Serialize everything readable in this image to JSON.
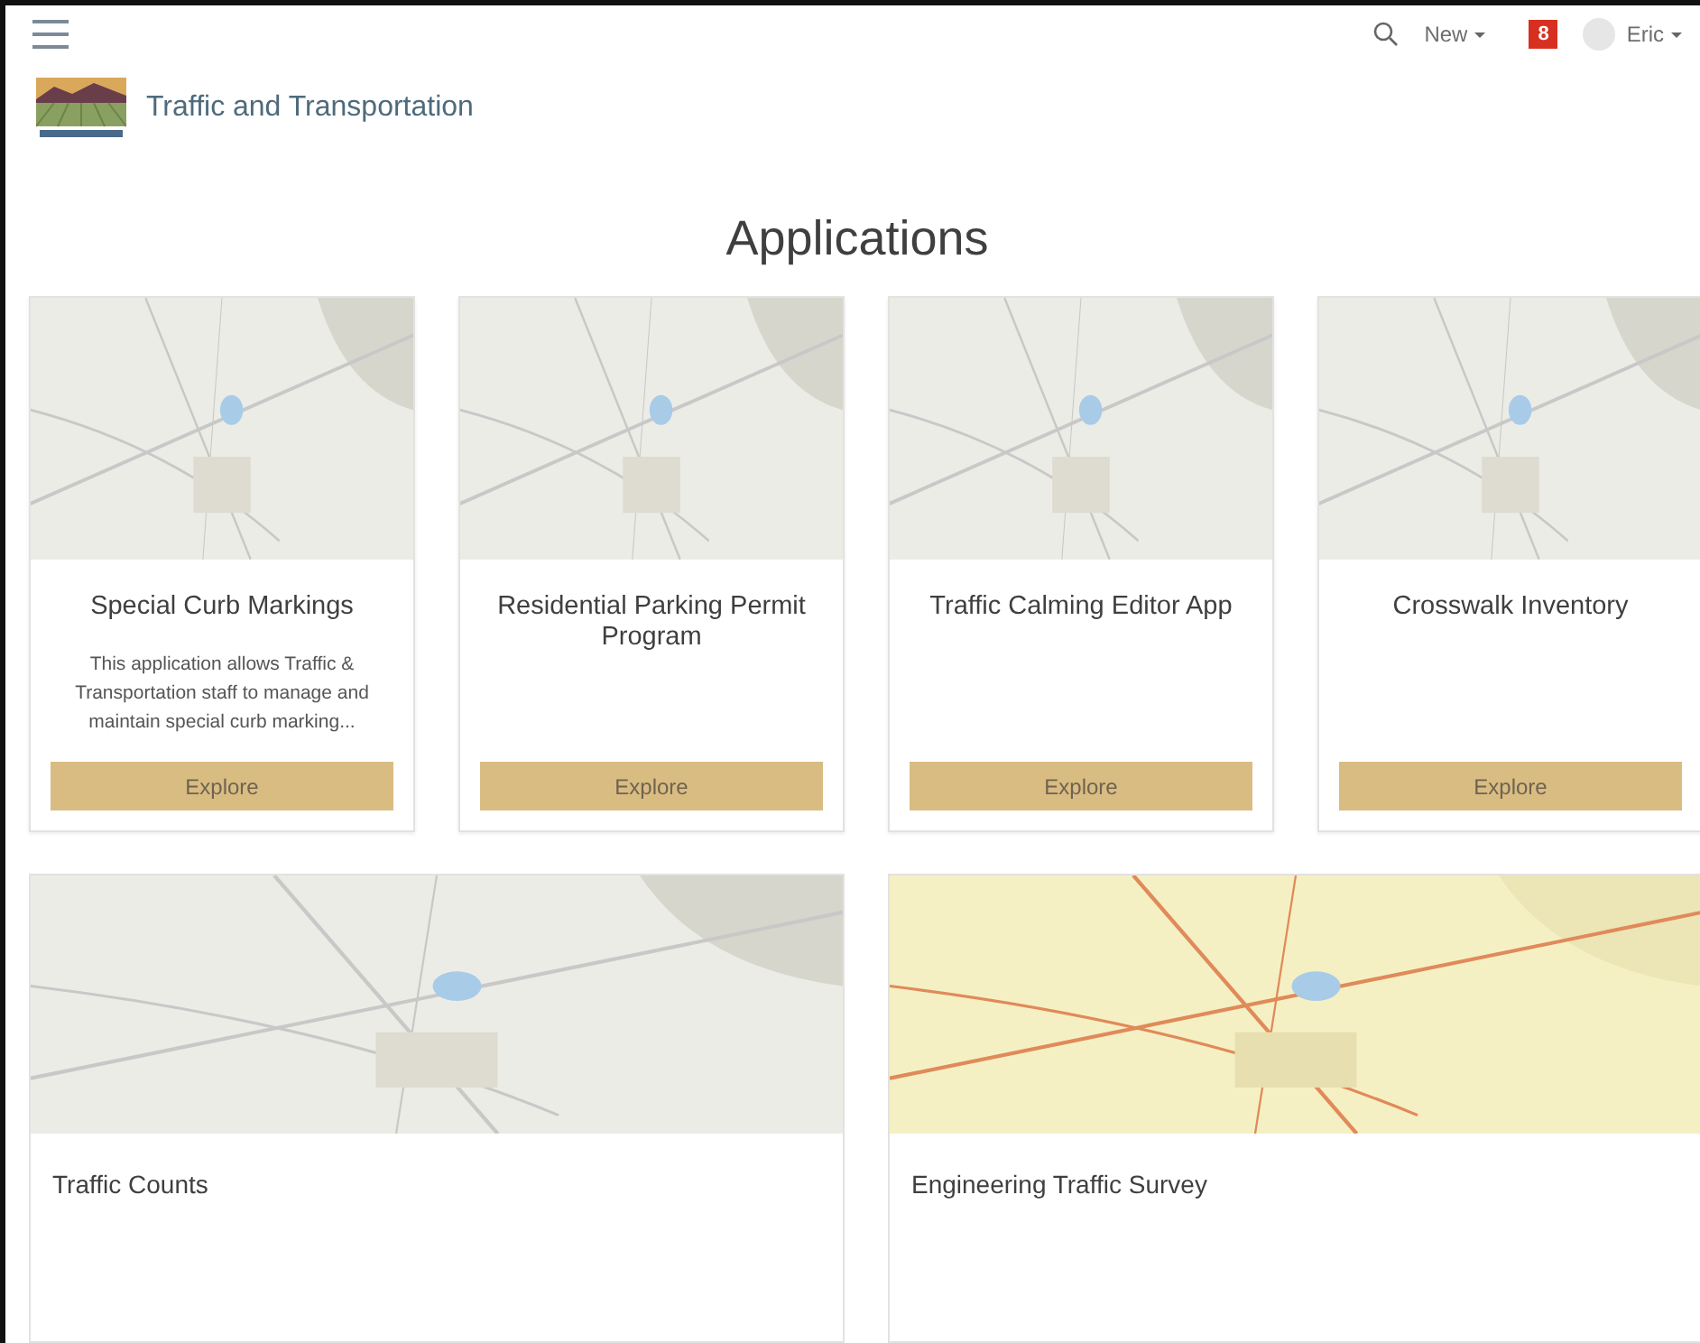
{
  "header": {
    "new_label": "New",
    "notifications": "8",
    "user": "Eric",
    "site_title": "Traffic and Transportation"
  },
  "heading": "Applications",
  "cards": [
    {
      "title": "Special Curb Markings",
      "description": "This application allows Traffic & Transportation staff to manage and maintain special curb marking...",
      "button": "Explore"
    },
    {
      "title": "Residential Parking Permit Program",
      "button": "Explore"
    },
    {
      "title": "Traffic Calming Editor App",
      "button": "Explore"
    },
    {
      "title": "Crosswalk Inventory",
      "button": "Explore"
    }
  ],
  "featured": [
    {
      "title": "Traffic Counts",
      "kind": "topo"
    },
    {
      "title": "Engineering Traffic Survey",
      "kind": "streets"
    }
  ]
}
